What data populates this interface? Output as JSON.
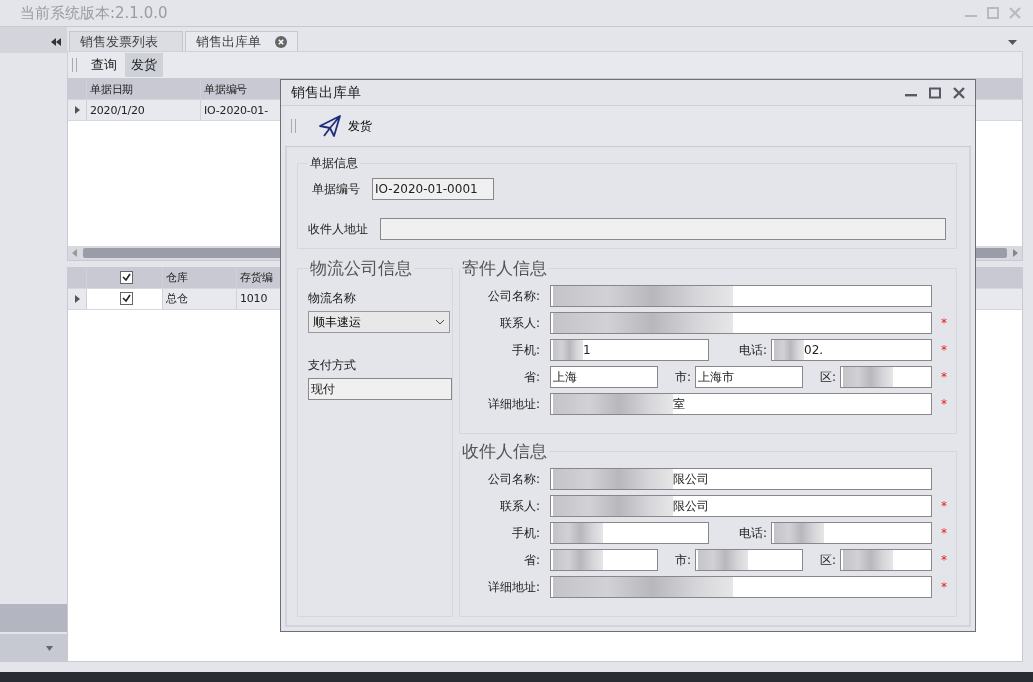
{
  "app": {
    "title": "当前系统版本:2.1.0.0"
  },
  "tabs": [
    {
      "label": "销售发票列表",
      "selected": false,
      "closable": false
    },
    {
      "label": "销售出库单",
      "selected": true,
      "closable": true
    }
  ],
  "toolbar": [
    {
      "label": "查询",
      "selected": false
    },
    {
      "label": "发货",
      "selected": true
    }
  ],
  "orders_table": {
    "columns": [
      "单据日期",
      "单据编号"
    ],
    "rows": [
      [
        "2020/1/20",
        "IO-2020-01-"
      ]
    ]
  },
  "items_table": {
    "header_checked": true,
    "columns": [
      "仓库",
      "存货编"
    ],
    "rows": [
      {
        "checked": true,
        "cells": [
          "总仓",
          "1010"
        ]
      }
    ]
  },
  "dialog": {
    "title": "销售出库单",
    "toolbar_button": "发货",
    "doc_section": {
      "legend": "单据信息",
      "number_label": "单据编号",
      "number_value": "IO-2020-01-0001",
      "address_label": "收件人地址"
    },
    "logistics": {
      "legend": "物流公司信息",
      "carrier_label": "物流名称",
      "carrier_value": "顺丰速运",
      "payment_label": "支付方式",
      "payment_value": "现付"
    },
    "parties": [
      {
        "legend": "寄件人信息",
        "rows": [
          {
            "fields": [
              {
                "label": "公司名称:",
                "blurred": true
              }
            ]
          },
          {
            "mark": "*",
            "fields": [
              {
                "label": "联系人:",
                "blurred": true
              }
            ]
          },
          {
            "mark": "*",
            "fields": [
              {
                "label": "手机:",
                "value": "1",
                "blurred": true
              },
              {
                "label": "电话:",
                "value": "02.",
                "blurred": true
              }
            ]
          },
          {
            "mark": "*",
            "fields": [
              {
                "label": "省:",
                "value": "上海",
                "blurred": false
              },
              {
                "label": "市:",
                "value": "上海市",
                "blurred": false
              },
              {
                "label": "区:",
                "blurred": true
              }
            ]
          },
          {
            "mark": "*",
            "fields": [
              {
                "label": "详细地址:",
                "value": "室",
                "blurred": true
              }
            ]
          }
        ]
      },
      {
        "legend": "收件人信息",
        "rows": [
          {
            "fields": [
              {
                "label": "公司名称:",
                "value": "限公司",
                "blurred": true
              }
            ]
          },
          {
            "mark": "*",
            "fields": [
              {
                "label": "联系人:",
                "value": "限公司",
                "blurred": true
              }
            ]
          },
          {
            "mark": "*",
            "fields": [
              {
                "label": "手机:",
                "blurred": true
              },
              {
                "label": "电话:",
                "blurred": true
              }
            ]
          },
          {
            "mark": "*",
            "fields": [
              {
                "label": "省:",
                "blurred": true
              },
              {
                "label": "市:",
                "blurred": true
              },
              {
                "label": "区:",
                "blurred": true
              }
            ]
          },
          {
            "mark": "*",
            "fields": [
              {
                "label": "详细地址:",
                "blurred": true
              }
            ]
          }
        ]
      }
    ]
  }
}
